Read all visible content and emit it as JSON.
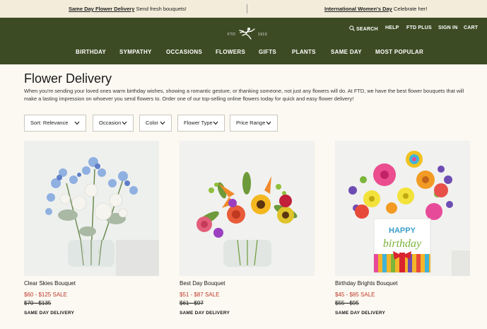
{
  "promo": {
    "left_link": "Same Day Flower Delivery",
    "left_text": "Send fresh bouquets!",
    "right_link": "International Women's Day",
    "right_text": "Celebrate her!"
  },
  "header": {
    "logo_left": "FTD",
    "logo_right": "1910",
    "utility": {
      "search": "SEARCH",
      "help": "HELP",
      "ftd_plus": "FTD PLUS",
      "sign_in": "SIGN IN",
      "cart": "CART"
    },
    "nav": [
      "BIRTHDAY",
      "SYMPATHY",
      "OCCASIONS",
      "FLOWERS",
      "GIFTS",
      "PLANTS",
      "SAME DAY",
      "MOST POPULAR"
    ]
  },
  "page": {
    "title": "Flower Delivery",
    "description": "When you're sending your loved ones warm birthday wishes, showing a romantic gesture, or thanking someone, not just any flowers will do. At FTD, we have the best flower bouquets that will make a lasting impression on whoever you send flowers to. Order one of our top-selling online flowers today for quick and easy flower delivery!"
  },
  "filters": {
    "sort": "Sort: Relevance",
    "occasion": "Occasion",
    "color": "Color",
    "flower_type": "Flower Type",
    "price_range": "Price Range"
  },
  "products": [
    {
      "name": "Clear Skies Bouquet",
      "sale": "$60 - $125 SALE",
      "original": "$70 - $135",
      "shipping": "SAME DAY DELIVERY"
    },
    {
      "name": "Best Day Bouquet",
      "sale": "$51 - $87 SALE",
      "original": "$61 - $97",
      "shipping": "SAME DAY DELIVERY"
    },
    {
      "name": "Birthday Brights Bouquet",
      "sale": "$45 - $85 SALE",
      "original": "$55 - $95",
      "shipping": "SAME DAY DELIVERY",
      "vase_text_1": "HAPPY",
      "vase_text_2": "birthday"
    }
  ],
  "colors": {
    "header_green": "#3d4b24",
    "promo_bg": "#f3ecda",
    "sale_red": "#c0392b",
    "page_bg": "#fbf9f1"
  }
}
